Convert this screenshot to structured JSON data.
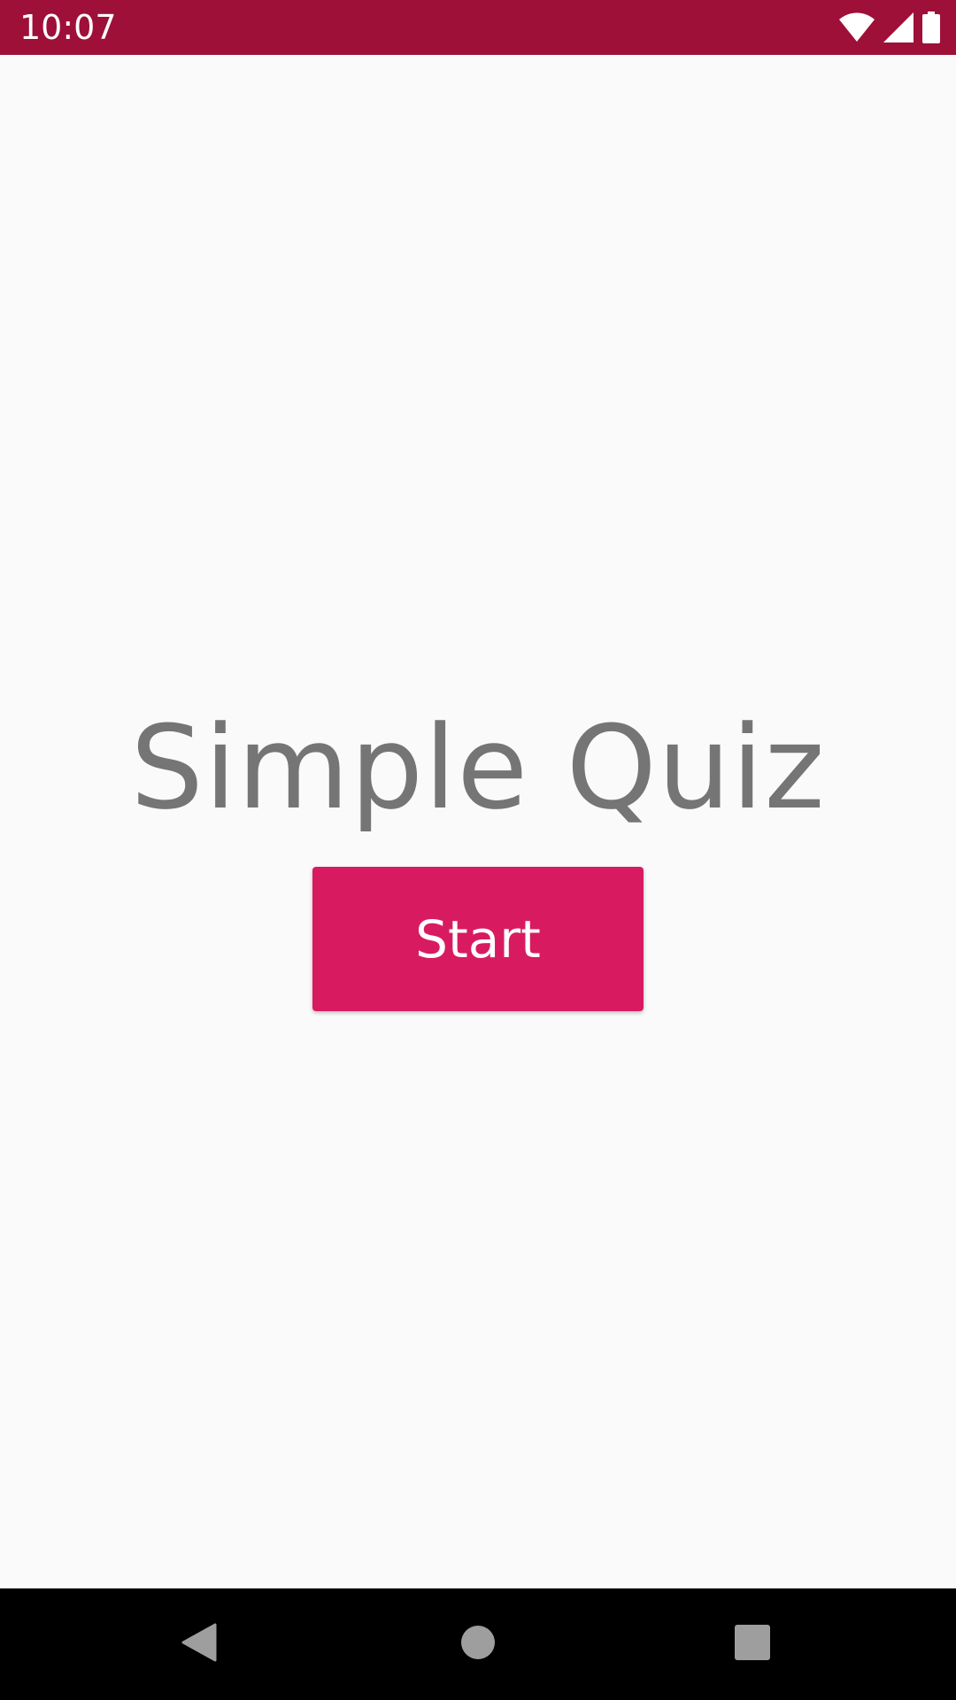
{
  "status_bar": {
    "time": "10:07",
    "background_color": "#9E1038",
    "icons": [
      "wifi-icon",
      "cell-signal-icon",
      "battery-icon"
    ]
  },
  "main": {
    "title": "Simple Quiz",
    "start_button_label": "Start",
    "accent_color": "#D81B60"
  },
  "nav_bar": {
    "buttons": [
      "back-icon",
      "home-icon",
      "recents-icon"
    ]
  }
}
